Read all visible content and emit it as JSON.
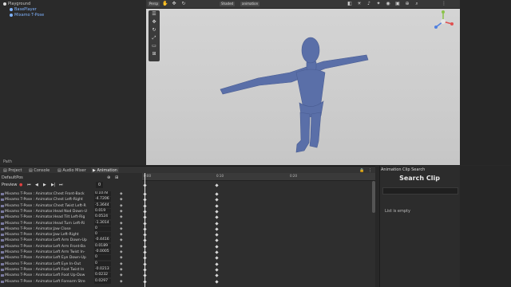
{
  "hierarchy": {
    "items": [
      {
        "label": "Playground",
        "color": "#dcdcdc"
      },
      {
        "label": "BasePlayer",
        "color": "#7fb3ff"
      },
      {
        "label": "Mixamo T-Pose",
        "color": "#7fb3ff"
      }
    ],
    "footer": "Path"
  },
  "scene_toolbar": {
    "left_label": "Persp",
    "shading_label": "Shaded",
    "draw_label": "animation"
  },
  "scene_tools": [
    "hand-tool-icon",
    "move-tool-icon",
    "rotate-tool-icon",
    "scale-tool-icon",
    "rect-tool-icon",
    "transform-tool-icon"
  ],
  "tabs": [
    {
      "label": "Project",
      "active": false
    },
    {
      "label": "Console",
      "active": false
    },
    {
      "label": "Audio Mixer",
      "active": false
    },
    {
      "label": "Animation",
      "active": true
    }
  ],
  "animation": {
    "clip_name": "DefaultPos",
    "preview_label": "Preview",
    "frame_value": "0",
    "timeline_labels": [
      "0:00",
      "0:10",
      "0:20"
    ],
    "properties": [
      {
        "name": "Mixamo T-Pose : Animator.Chest Front-Back",
        "value": "0.1078"
      },
      {
        "name": "Mixamo T-Pose : Animator.Chest Left-Right",
        "value": "-4.7206"
      },
      {
        "name": "Mixamo T-Pose : Animator.Chest Twist Left-R",
        "value": "-5.3644"
      },
      {
        "name": "Mixamo T-Pose : Animator.Head Nod Down-U",
        "value": "0.019"
      },
      {
        "name": "Mixamo T-Pose : Animator.Head Tilt Left-Rig",
        "value": "0.0524"
      },
      {
        "name": "Mixamo T-Pose : Animator.Head Turn Left-Ri",
        "value": "-1.3014"
      },
      {
        "name": "Mixamo T-Pose : Animator.Jaw Close",
        "value": "0"
      },
      {
        "name": "Mixamo T-Pose : Animator.Jaw Left-Right",
        "value": "0"
      },
      {
        "name": "Mixamo T-Pose : Animator.Left Arm Down-Up",
        "value": "-0.4416"
      },
      {
        "name": "Mixamo T-Pose : Animator.Left Arm Front-Ba",
        "value": "0.0189"
      },
      {
        "name": "Mixamo T-Pose : Animator.Left Arm Twist In-",
        "value": "-0.0005"
      },
      {
        "name": "Mixamo T-Pose : Animator.Left Eye Down-Up",
        "value": "0"
      },
      {
        "name": "Mixamo T-Pose : Animator.Left Eye In-Out",
        "value": "0"
      },
      {
        "name": "Mixamo T-Pose : Animator.Left Foot Twist In",
        "value": "-0.0213"
      },
      {
        "name": "Mixamo T-Pose : Animator.Left Foot Up-Dow",
        "value": "0.0232"
      },
      {
        "name": "Mixamo T-Pose : Animator.Left Forearm Stre",
        "value": "0.0297"
      }
    ]
  },
  "clip_search": {
    "tab_label": "Animation Clip Search",
    "heading": "Search Clip",
    "empty_text": "List is empty"
  },
  "colors": {
    "figure": "#5a6fa8",
    "scene_bg": "#cfcfcf",
    "panel_bg": "#2c2c2c"
  }
}
